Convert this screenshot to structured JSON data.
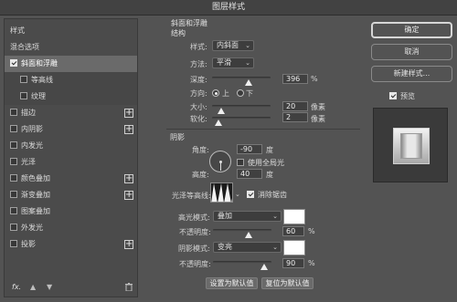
{
  "window": {
    "title": "图层样式"
  },
  "left_panel": {
    "header": "样式",
    "blend_options": "混合选项",
    "items": [
      {
        "label": "斜面和浮雕",
        "checked": true,
        "selected": true,
        "has_plus": false,
        "sub": false
      },
      {
        "label": "等高线",
        "checked": false,
        "selected": false,
        "has_plus": false,
        "sub": true
      },
      {
        "label": "纹理",
        "checked": false,
        "selected": false,
        "has_plus": false,
        "sub": true
      },
      {
        "label": "描边",
        "checked": false,
        "selected": false,
        "has_plus": true,
        "sub": false
      },
      {
        "label": "内阴影",
        "checked": false,
        "selected": false,
        "has_plus": true,
        "sub": false
      },
      {
        "label": "内发光",
        "checked": false,
        "selected": false,
        "has_plus": false,
        "sub": false
      },
      {
        "label": "光泽",
        "checked": false,
        "selected": false,
        "has_plus": false,
        "sub": false
      },
      {
        "label": "颜色叠加",
        "checked": false,
        "selected": false,
        "has_plus": true,
        "sub": false
      },
      {
        "label": "渐变叠加",
        "checked": false,
        "selected": false,
        "has_plus": true,
        "sub": false
      },
      {
        "label": "图案叠加",
        "checked": false,
        "selected": false,
        "has_plus": false,
        "sub": false
      },
      {
        "label": "外发光",
        "checked": false,
        "selected": false,
        "has_plus": false,
        "sub": false
      },
      {
        "label": "投影",
        "checked": false,
        "selected": false,
        "has_plus": true,
        "sub": false
      }
    ],
    "footer": {
      "fx": "fx.",
      "up_icon": "arrow-up-icon",
      "down_icon": "arrow-down-icon",
      "trash_icon": "trash-icon"
    }
  },
  "bevel": {
    "section_title": "斜面和浮雕",
    "structure_title": "结构",
    "style_label": "样式:",
    "style_value": "内斜面",
    "method_label": "方法:",
    "method_value": "平滑",
    "depth_label": "深度:",
    "depth_value": "396",
    "depth_unit": "%",
    "direction_label": "方向:",
    "direction_up": "上",
    "direction_down": "下",
    "direction_selected": "up",
    "size_label": "大小:",
    "size_value": "20",
    "size_unit": "像素",
    "soften_label": "软化:",
    "soften_value": "2",
    "soften_unit": "像素"
  },
  "shading": {
    "title": "阴影",
    "angle_label": "角度:",
    "angle_value": "-90",
    "angle_unit": "度",
    "global_light_label": "使用全局光",
    "global_light_checked": false,
    "altitude_label": "高度:",
    "altitude_value": "40",
    "altitude_unit": "度",
    "gloss_contour_label": "光泽等高线:",
    "antialias_label": "消除锯齿",
    "antialias_checked": true,
    "highlight_mode_label": "高光模式:",
    "highlight_mode_value": "叠加",
    "highlight_color": "#ffffff",
    "highlight_opacity_label": "不透明度:",
    "highlight_opacity_value": "60",
    "highlight_opacity_unit": "%",
    "shadow_mode_label": "阴影模式:",
    "shadow_mode_value": "变亮",
    "shadow_color": "#ffffff",
    "shadow_opacity_label": "不透明度:",
    "shadow_opacity_value": "90",
    "shadow_opacity_unit": "%"
  },
  "bottom_buttons": {
    "make_default": "设置为默认值",
    "reset_default": "复位为默认值"
  },
  "right_panel": {
    "ok": "确定",
    "cancel": "取消",
    "new_style": "新建样式...",
    "preview_label": "预览",
    "preview_checked": true
  }
}
